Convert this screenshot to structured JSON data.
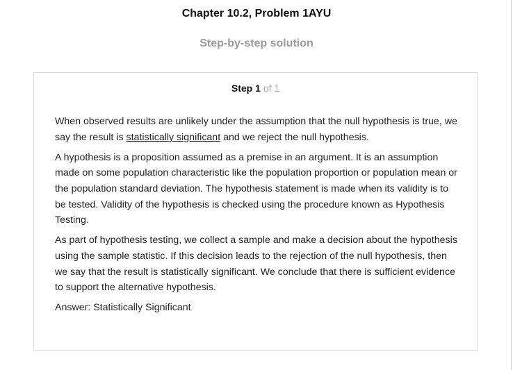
{
  "header": {
    "title": "Chapter 10.2, Problem 1AYU",
    "subtitle": "Step-by-step solution"
  },
  "step": {
    "label": "Step",
    "number": "1",
    "of_text": "of 1"
  },
  "solution": {
    "p1_before": "When observed results are unlikely under the assumption that the null hypothesis is true, we say the result is ",
    "p1_link": "statistically significant",
    "p1_after": " and we reject the null hypothesis.",
    "p2": "A hypothesis is a proposition assumed as a premise in an argument. It is an assumption made on some population characteristic like the population proportion or population mean or the population standard deviation. The hypothesis statement is made when its validity is to be tested. Validity of the hypothesis is checked using the procedure known as Hypothesis Testing.",
    "p3": "As part of hypothesis testing, we collect a sample and make a decision about the hypothesis using the sample statistic. If this decision leads to the rejection of the null hypothesis, then we say that the result is statistically significant. We conclude that there is sufficient evidence to support the alternative hypothesis.",
    "answer": "Answer: Statistically Significant"
  }
}
